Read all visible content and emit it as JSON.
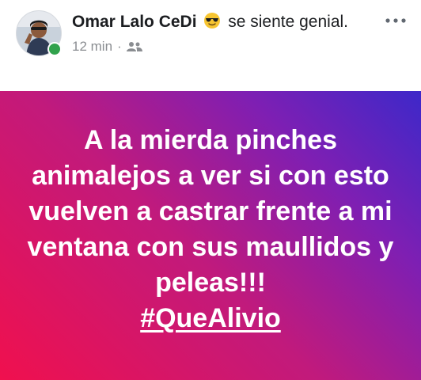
{
  "post": {
    "author": "Omar Lalo CeDi",
    "feeling_emoji": "sunglasses-emoji",
    "feeling_text": "se siente genial.",
    "timestamp": "12 min",
    "separator": "·",
    "audience_icon": "friends-icon",
    "more_icon": "more-options-icon",
    "body_text": "A la mierda pinches animalejos a ver si con esto vuelven a castrar frente a mi ventana con sus maullidos y peleas!!!",
    "hashtag": "#QueAlivio"
  },
  "colors": {
    "gradient_start": "#f0104e",
    "gradient_end": "#3d28c9",
    "online": "#31a24c",
    "meta_gray": "#8a8d91"
  }
}
